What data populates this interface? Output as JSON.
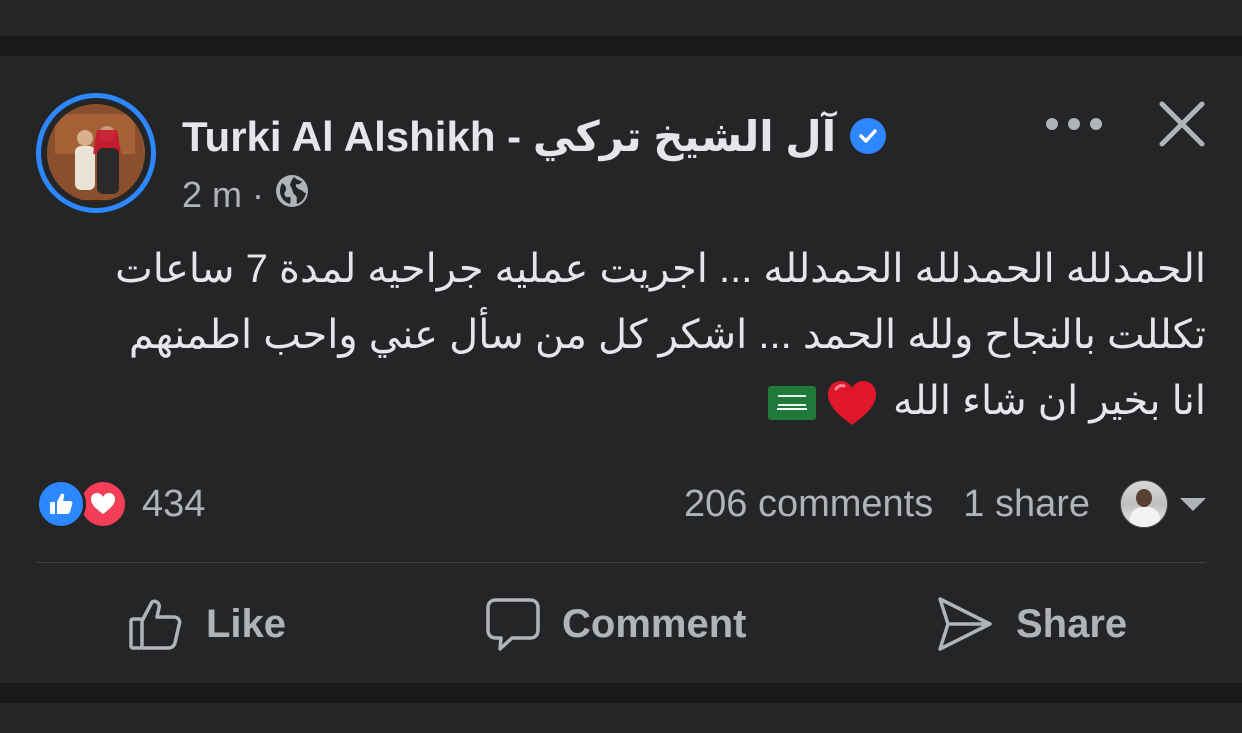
{
  "post": {
    "author": "Turki Al Alshikh - آل  الشيخ  تركي",
    "timestamp": "2 m",
    "separator": "·",
    "privacy_icon": "globe-icon",
    "verified_icon": "verified-badge-icon",
    "text_lines": [
      "الحمدلله الحمدلله الحمدلله ... اجريت عمليه جراحيه لمدة 7 ساعات",
      "تكللت بالنجاح ولله الحمد ... اشكر كل من سأل عني واحب اطمنهم",
      "انا بخير ان شاء الله"
    ]
  },
  "stats": {
    "reaction_count": "434",
    "comments": "206 comments",
    "shares": "1 share"
  },
  "actions": {
    "like": "Like",
    "comment": "Comment",
    "share": "Share"
  },
  "colors": {
    "background": "#18191a",
    "card": "#242526",
    "accent": "#2d88ff",
    "love": "#f33e58",
    "secondary_text": "#b0b3b8",
    "primary_text": "#e4e6eb"
  }
}
